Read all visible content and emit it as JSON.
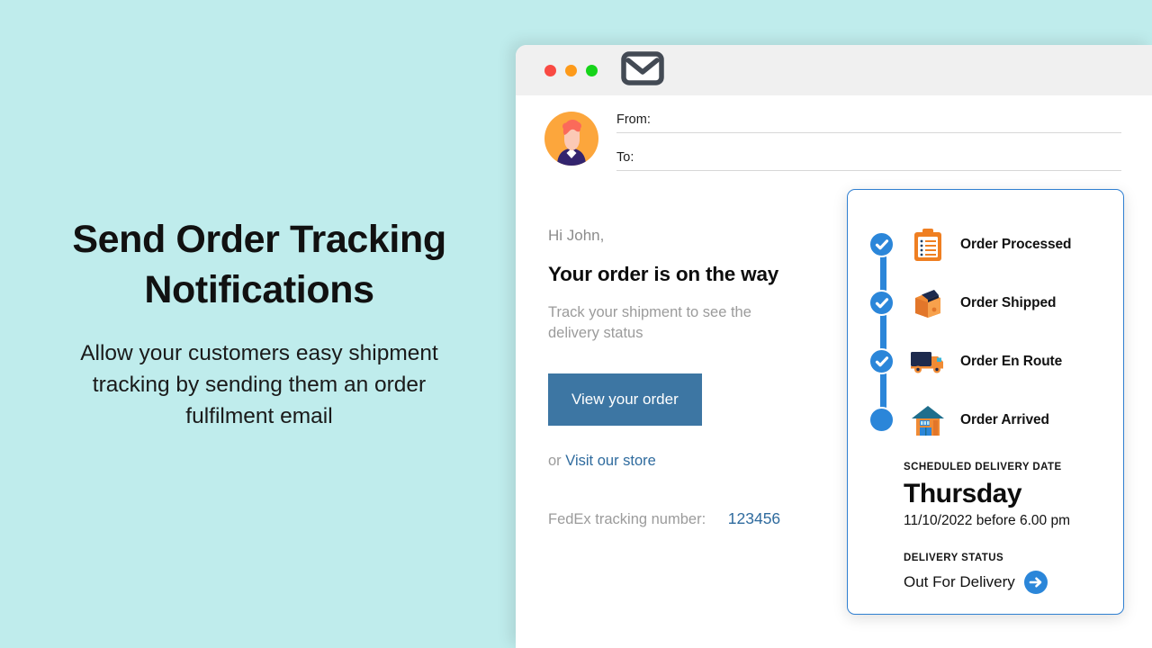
{
  "promo": {
    "heading": "Send Order Tracking Notifications",
    "subtext": "Allow your customers easy shipment tracking by sending them an order fulfilment email"
  },
  "window": {
    "dots": [
      "red",
      "amber",
      "green"
    ],
    "app_icon": "envelope-icon"
  },
  "email_header": {
    "avatar": "user-avatar",
    "from_label": "From:",
    "to_label": "To:"
  },
  "email_body": {
    "greeting": "Hi John,",
    "subject": "Your order is on the way",
    "subtitle": "Track your shipment to see the delivery status",
    "cta_label": "View your order",
    "store_prefix": "or",
    "store_link": "Visit our store",
    "tracking_label": "FedEx tracking number:",
    "tracking_number": "123456"
  },
  "tracking_card": {
    "steps": [
      {
        "label": "Order Processed",
        "icon": "clipboard-icon",
        "state": "complete"
      },
      {
        "label": "Order Shipped",
        "icon": "package-box-icon",
        "state": "complete"
      },
      {
        "label": "Order En Route",
        "icon": "delivery-truck-icon",
        "state": "complete"
      },
      {
        "label": "Order Arrived",
        "icon": "storefront-icon",
        "state": "current"
      }
    ],
    "scheduled_caption": "SCHEDULED DELIVERY DATE",
    "delivery_day": "Thursday",
    "delivery_datetime": "11/10/2022 before 6.00 pm",
    "status_caption": "DELIVERY STATUS",
    "status_text": "Out For Delivery",
    "status_icon": "arrow-right-circle-icon"
  },
  "colors": {
    "background_teal": "#bfecec",
    "accent_orange": "#ef7f22",
    "accent_blue": "#2b86d9",
    "card_border_blue": "#2f7fd1",
    "button_blue": "#3d76a3",
    "link_blue": "#2f6b9e"
  }
}
